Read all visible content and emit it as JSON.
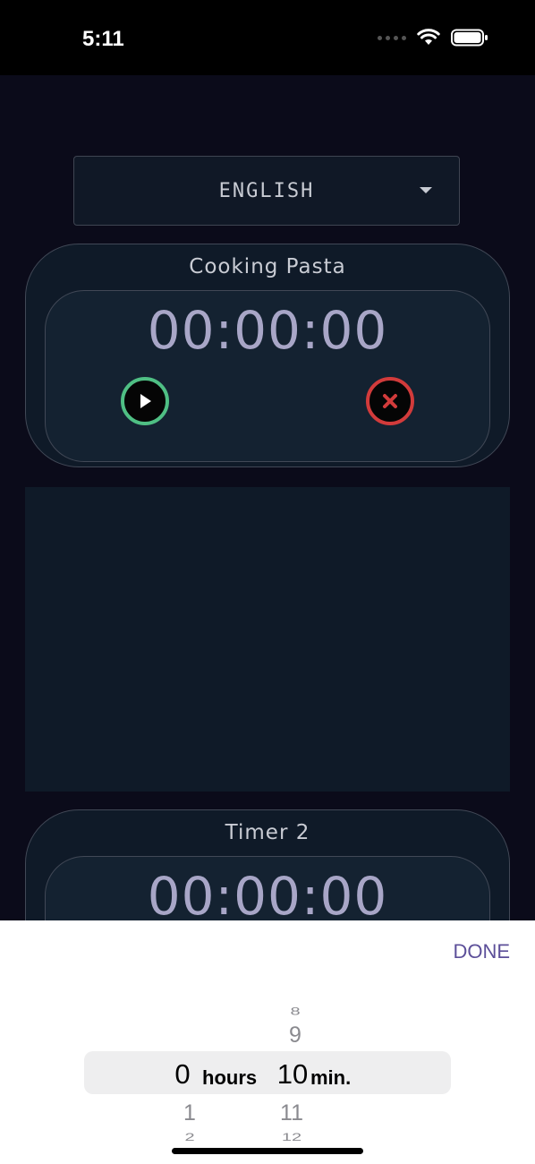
{
  "status_bar": {
    "time": "5:11"
  },
  "language_select": {
    "value": "ENGLISH"
  },
  "timers": [
    {
      "title": "Cooking Pasta",
      "display": "00:00:00"
    },
    {
      "title": "Timer 2",
      "display": "00:00:00"
    }
  ],
  "picker": {
    "done_label": "DONE",
    "hours": {
      "above": [
        "",
        ""
      ],
      "selected": "0",
      "below": [
        "1",
        "2"
      ],
      "unit": "hours"
    },
    "minutes": {
      "above": [
        "8",
        "9"
      ],
      "selected": "10",
      "below": [
        "11",
        "12"
      ],
      "unit": "min."
    }
  },
  "colors": {
    "play": "#4fbf84",
    "cancel": "#d23b3b",
    "accent": "#5c4f99",
    "timer_text": "#a8a6c7"
  }
}
